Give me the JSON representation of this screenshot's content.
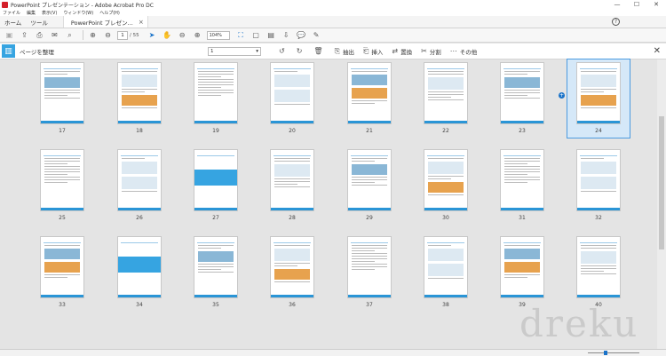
{
  "window": {
    "title": "PowerPoint プレゼンテーション - Adobe Acrobat Pro DC",
    "controls": [
      "—",
      "☐",
      "✕"
    ]
  },
  "menu": [
    "ファイル",
    "編集",
    "表示(V)",
    "ウィンドウ(W)",
    "ヘルプ(H)"
  ],
  "tabs": {
    "home": "ホーム",
    "tools": "ツール",
    "document": "PowerPoint プレゼン...",
    "close": "×",
    "help": "?"
  },
  "toolbar": {
    "page_current": "1",
    "page_total": "/ 55",
    "zoom": "104%"
  },
  "organize": {
    "title": "ページを整理",
    "range": "1",
    "extract": "抽出",
    "insert": "挿入",
    "replace": "置換",
    "split": "分割",
    "more": "その他",
    "close": "✕"
  },
  "pages": [
    "17",
    "18",
    "19",
    "20",
    "21",
    "22",
    "23",
    "24",
    "25",
    "26",
    "27",
    "28",
    "29",
    "30",
    "31",
    "32",
    "33",
    "34",
    "35",
    "36",
    "37",
    "38",
    "39",
    "40"
  ],
  "selected_page": "24",
  "watermark": "dreku",
  "colors": {
    "accent": "#36a4e1",
    "selection": "#d5e8f8"
  }
}
